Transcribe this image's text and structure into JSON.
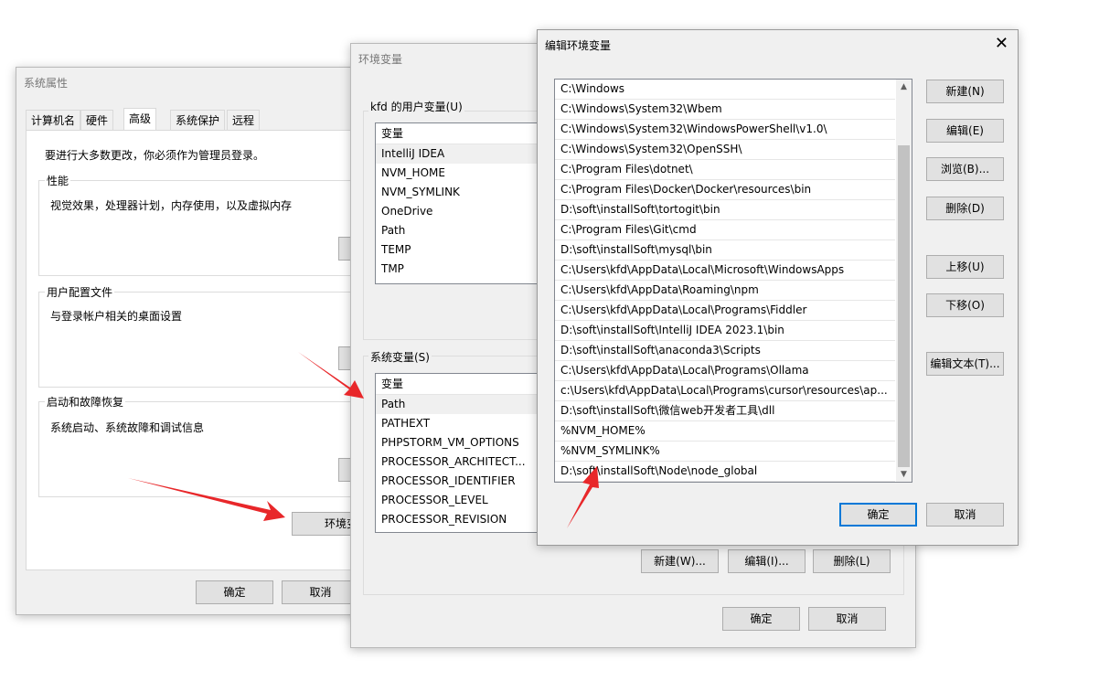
{
  "sys_props": {
    "title": "系统属性",
    "tabs": [
      "计算机名",
      "硬件",
      "高级",
      "系统保护",
      "远程"
    ],
    "admin_note": "要进行大多数更改，你必须作为管理员登录。",
    "perf_label": "性能",
    "perf_desc": "视觉效果，处理器计划，内存使用，以及虚拟内存",
    "profile_label": "用户配置文件",
    "profile_desc": "与登录帐户相关的桌面设置",
    "startup_label": "启动和故障恢复",
    "startup_desc": "系统启动、系统故障和调试信息",
    "env_button": "环境变",
    "ok": "确定",
    "cancel": "取消"
  },
  "env_vars": {
    "title": "环境变量",
    "user_label": "kfd 的用户变量(U)",
    "user_header": "变量",
    "user_vars": [
      "IntelliJ IDEA",
      "NVM_HOME",
      "NVM_SYMLINK",
      "OneDrive",
      "Path",
      "TEMP",
      "TMP"
    ],
    "sys_label": "系统变量(S)",
    "sys_header": "变量",
    "sys_vars": [
      "Path",
      "PATHEXT",
      "PHPSTORM_VM_OPTIONS",
      "PROCESSOR_ARCHITECT...",
      "PROCESSOR_IDENTIFIER",
      "PROCESSOR_LEVEL",
      "PROCESSOR_REVISION"
    ],
    "new_btn": "新建(W)...",
    "edit_btn": "编辑(I)...",
    "delete_btn": "删除(L)",
    "ok": "确定",
    "cancel": "取消"
  },
  "edit_env": {
    "title": "编辑环境变量",
    "entries": [
      "C:\\Windows",
      "C:\\Windows\\System32\\Wbem",
      "C:\\Windows\\System32\\WindowsPowerShell\\v1.0\\",
      "C:\\Windows\\System32\\OpenSSH\\",
      "C:\\Program Files\\dotnet\\",
      "C:\\Program Files\\Docker\\Docker\\resources\\bin",
      "D:\\soft\\installSoft\\tortogit\\bin",
      "C:\\Program Files\\Git\\cmd",
      "D:\\soft\\installSoft\\mysql\\bin",
      "C:\\Users\\kfd\\AppData\\Local\\Microsoft\\WindowsApps",
      "C:\\Users\\kfd\\AppData\\Roaming\\npm",
      "C:\\Users\\kfd\\AppData\\Local\\Programs\\Fiddler",
      "D:\\soft\\installSoft\\IntelliJ IDEA 2023.1\\bin",
      "D:\\soft\\installSoft\\anaconda3\\Scripts",
      "C:\\Users\\kfd\\AppData\\Local\\Programs\\Ollama",
      "c:\\Users\\kfd\\AppData\\Local\\Programs\\cursor\\resources\\ap...",
      "D:\\soft\\installSoft\\微信web开发者工具\\dll",
      "%NVM_HOME%",
      "%NVM_SYMLINK%",
      "D:\\soft\\installSoft\\Node\\node_global"
    ],
    "buttons": {
      "new": "新建(N)",
      "edit": "编辑(E)",
      "browse": "浏览(B)...",
      "delete": "删除(D)",
      "move_up": "上移(U)",
      "move_down": "下移(O)",
      "edit_text": "编辑文本(T)..."
    },
    "ok": "确定",
    "cancel": "取消",
    "close_glyph": "✕"
  },
  "colors": {
    "accent": "#0078d7",
    "arrow": "#e8272a"
  }
}
